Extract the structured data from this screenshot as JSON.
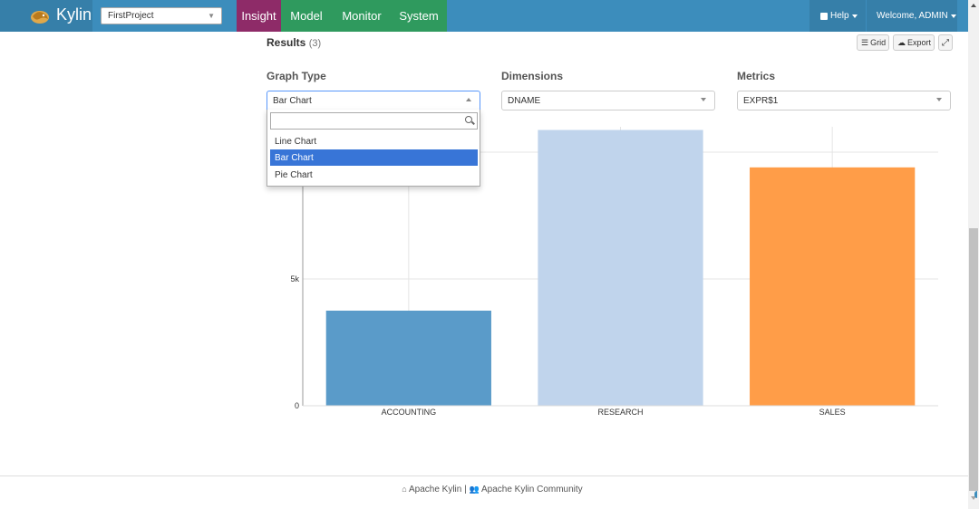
{
  "navbar": {
    "brand": "Kylin",
    "project": "FirstProject",
    "tabs": [
      "Insight",
      "Model",
      "Monitor",
      "System"
    ],
    "active_tab": "Insight",
    "help_label": "Help",
    "welcome_label": "Welcome, ADMIN",
    "colors": {
      "bar": "#3c8dbc",
      "brand_bg": "#367fa9",
      "insight": "#8e2b68",
      "tab_group": "#2f9a5e"
    }
  },
  "results": {
    "title": "Results",
    "count": "(3)",
    "grid_label": "Grid",
    "export_label": "Export"
  },
  "form": {
    "graph_type_label": "Graph Type",
    "dimensions_label": "Dimensions",
    "metrics_label": "Metrics",
    "graph_type_value": "Bar Chart",
    "dimensions_value": "DNAME",
    "metrics_value": "EXPR$1",
    "dropdown_options": [
      "Line Chart",
      "Bar Chart",
      "Pie Chart"
    ],
    "dropdown_selected": "Bar Chart",
    "search_placeholder": ""
  },
  "chart_data": {
    "type": "bar",
    "categories": [
      "ACCOUNTING",
      "RESEARCH",
      "SALES"
    ],
    "values": [
      3750,
      10875,
      9400
    ],
    "colors": [
      "#5a9bc9",
      "#c0d4ec",
      "#ff9d48"
    ],
    "ytick_labels": [
      "0",
      "5k"
    ],
    "yticks": [
      0,
      5000,
      10000
    ],
    "ylim": [
      0,
      11000
    ],
    "grid": true
  },
  "footer": {
    "link1": "Apache Kylin",
    "separator": "|",
    "link2": "Apache Kylin Community"
  }
}
